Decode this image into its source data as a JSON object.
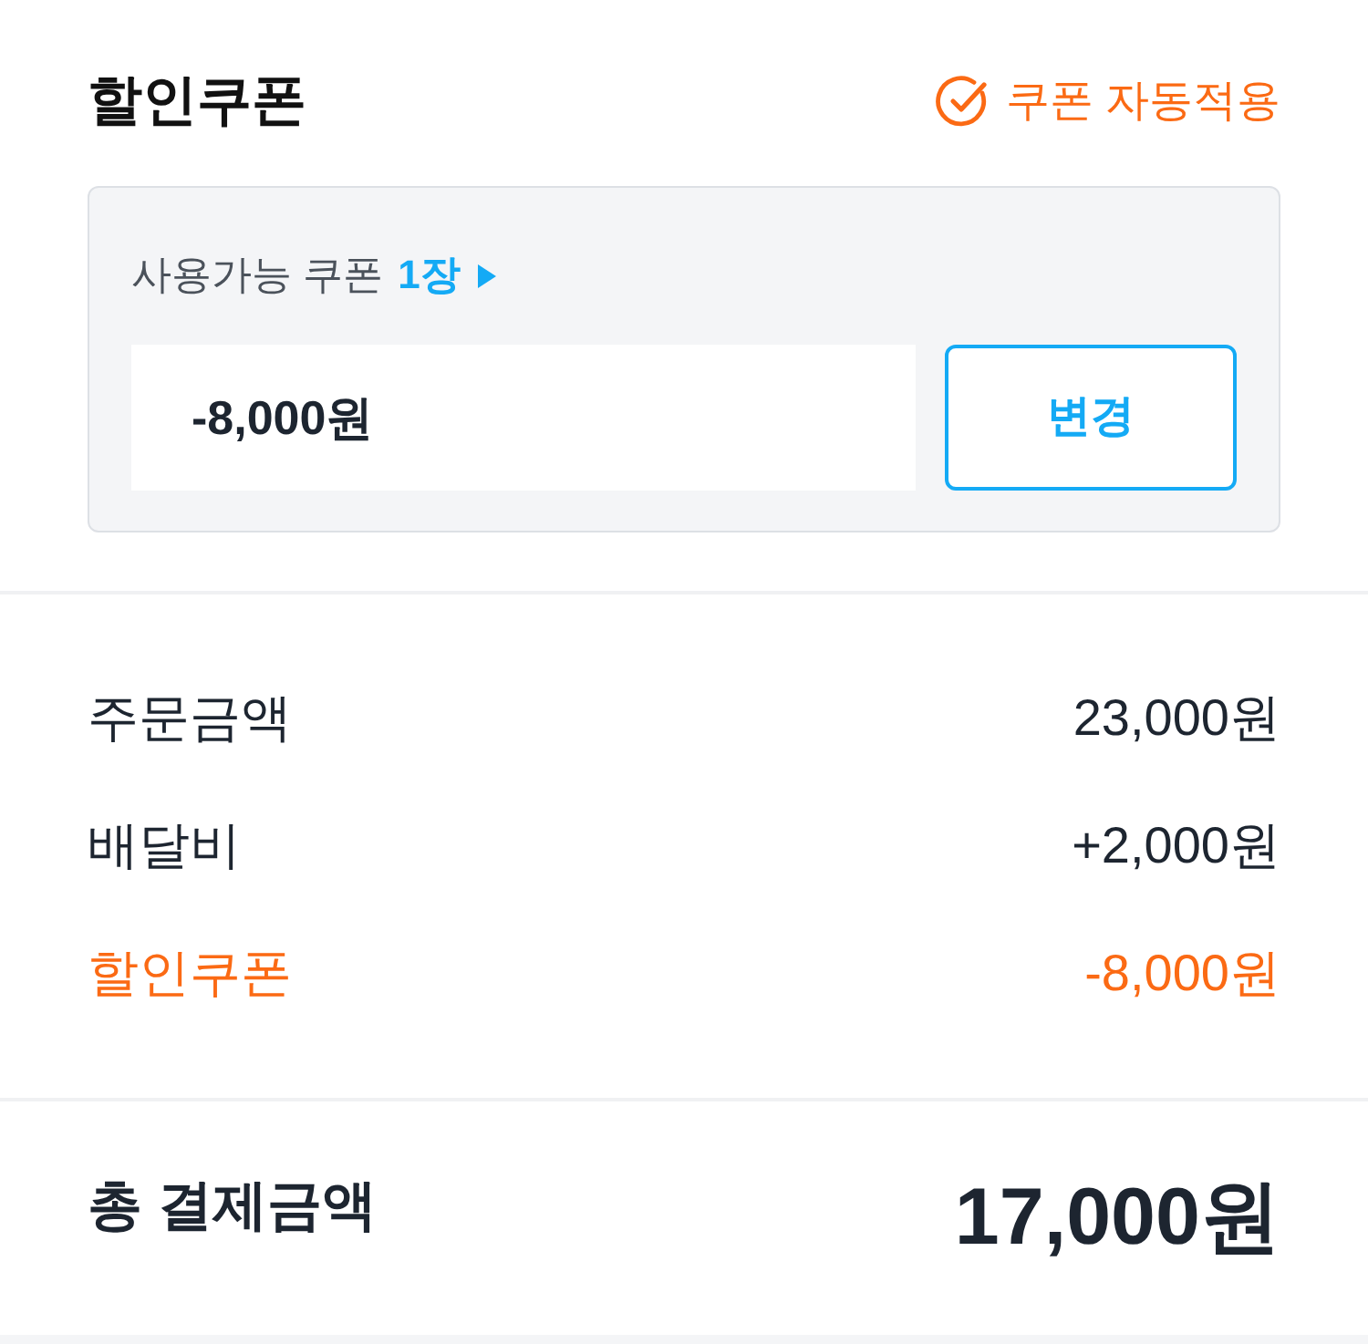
{
  "header": {
    "title": "할인쿠폰",
    "auto_apply": {
      "label": "쿠폰 자동적용",
      "checked": true
    }
  },
  "coupon_box": {
    "available_label": "사용가능 쿠폰",
    "available_count": "1장",
    "value": "-8,000원",
    "change_button": "변경"
  },
  "summary": {
    "rows": [
      {
        "label": "주문금액",
        "amount": "23,000원",
        "kind": "charge"
      },
      {
        "label": "배달비",
        "amount": "+2,000원",
        "kind": "charge"
      },
      {
        "label": "할인쿠폰",
        "amount": "-8,000원",
        "kind": "discount"
      }
    ]
  },
  "total": {
    "label": "총 결제금액",
    "amount": "17,000원"
  }
}
